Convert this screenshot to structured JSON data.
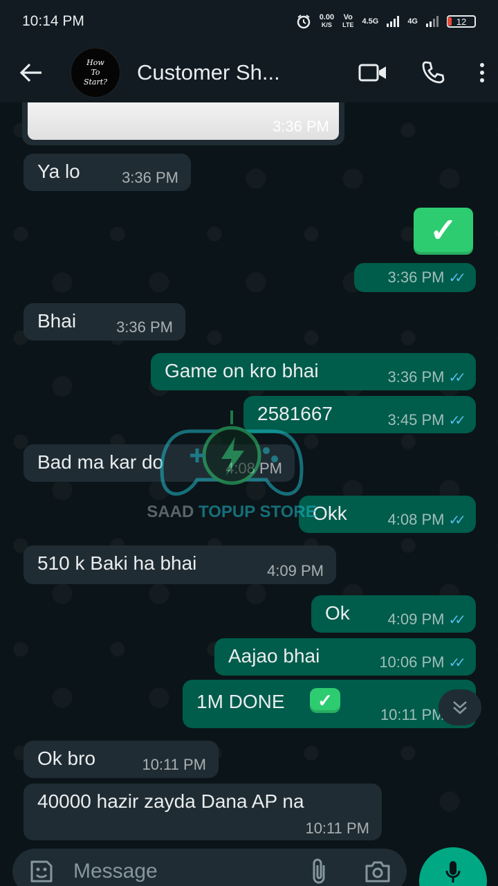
{
  "status_bar": {
    "time": "10:14 PM",
    "net_speed": "0.00",
    "net_unit": "K/S",
    "volte": "Vo",
    "lte": "LTE",
    "sim1": "4.5G",
    "sim2": "4G",
    "battery": "12"
  },
  "header": {
    "contact_name": "Customer Sh...",
    "avatar_text": [
      "How",
      "To",
      "Start?"
    ],
    "icons": [
      "back-arrow-icon",
      "video-call-icon",
      "phone-icon",
      "more-icon"
    ]
  },
  "watermark": {
    "part1": "SAAD",
    "part2": "TOPUP STORE"
  },
  "messages": [
    {
      "side": "in",
      "type": "image",
      "time": "3:36 PM"
    },
    {
      "side": "in",
      "text": "Ya lo",
      "time": "3:36 PM"
    },
    {
      "side": "out",
      "type": "emoji",
      "emoji": "check-mark-button",
      "time": "3:36 PM"
    },
    {
      "side": "in",
      "text": "Bhai",
      "time": "3:36 PM"
    },
    {
      "side": "out",
      "text": "Game on kro bhai",
      "time": "3:36 PM"
    },
    {
      "side": "out",
      "text": "2581667",
      "time": "3:45 PM"
    },
    {
      "side": "in",
      "text": "Bad ma kar do",
      "time": "4:08 PM"
    },
    {
      "side": "out",
      "text": "Okk",
      "time": "4:08 PM"
    },
    {
      "side": "in",
      "text": "510 k Baki ha bhai",
      "time": "4:09 PM"
    },
    {
      "side": "out",
      "text": "Ok",
      "time": "4:09 PM"
    },
    {
      "side": "out",
      "text": "Aajao bhai",
      "time": "10:06 PM"
    },
    {
      "side": "out",
      "text": "1M DONE",
      "emoji": "check-mark-button",
      "time": "10:11 PM"
    },
    {
      "side": "in",
      "text": "Ok bro",
      "time": "10:11 PM"
    },
    {
      "side": "in",
      "text": "40000 hazir zayda Dana AP na",
      "time": "10:11 PM"
    }
  ],
  "composer": {
    "placeholder": "Message",
    "icons": [
      "sticker-icon",
      "attach-icon",
      "camera-icon",
      "mic-icon"
    ]
  },
  "colors": {
    "incoming_bubble": "#202c33",
    "outgoing_bubble": "#005c4b",
    "read_ticks": "#53bdeb",
    "accent": "#00a884"
  }
}
